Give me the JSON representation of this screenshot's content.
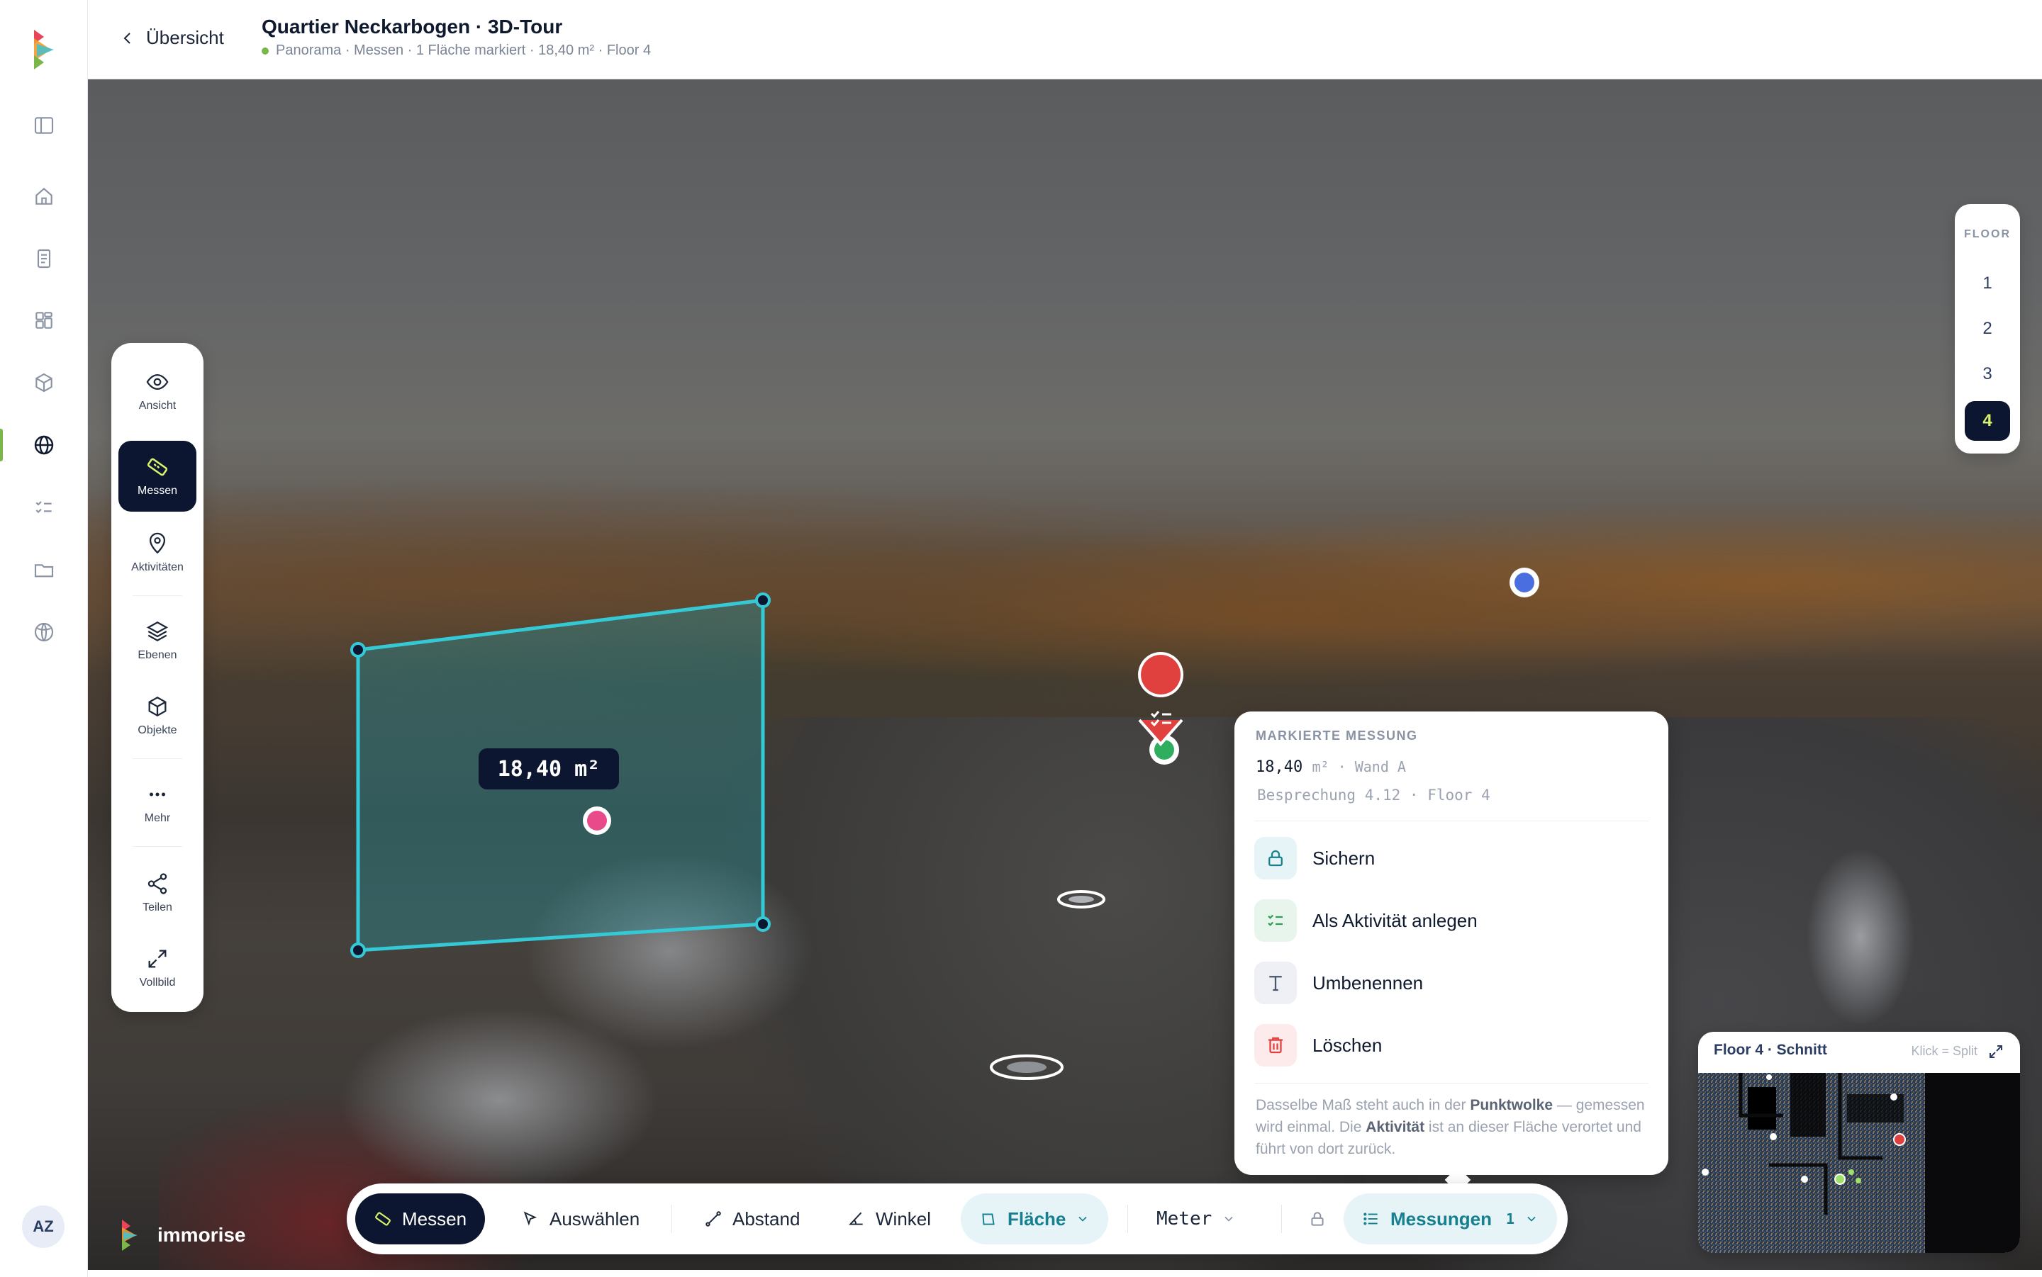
{
  "header": {
    "back_label": "Übersicht",
    "title": "Quartier Neckarbogen · 3D-Tour",
    "subtitle": "Panorama · Messen · 1 Fläche markiert · 18,40 m² · Floor 4"
  },
  "globalnav": {
    "items": [
      "sidebar-toggle-icon",
      "home-icon",
      "document-icon",
      "dashboard-icon",
      "cube-icon",
      "globe-icon",
      "checklist-icon",
      "folder-icon",
      "planet-icon"
    ],
    "active": "globe-icon",
    "avatar_initials": "AZ"
  },
  "rail": {
    "items": [
      {
        "label": "Ansicht",
        "icon": "eye-icon"
      },
      {
        "label": "Messen",
        "icon": "ruler-icon"
      },
      {
        "label": "Aktivitäten",
        "icon": "pin-icon"
      },
      {
        "label": "Ebenen",
        "icon": "layers-icon"
      },
      {
        "label": "Objekte",
        "icon": "cube-icon"
      },
      {
        "label": "Mehr",
        "icon": "more-icon"
      },
      {
        "label": "Teilen",
        "icon": "share-icon"
      },
      {
        "label": "Vollbild",
        "icon": "fullscreen-icon"
      }
    ],
    "active": "Messen"
  },
  "floors": {
    "heading": "FLOOR",
    "items": [
      "1",
      "2",
      "3",
      "4"
    ],
    "active": "4"
  },
  "measurement": {
    "label": "18,40 m²"
  },
  "popover": {
    "heading": "MARKIERTE MESSUNG",
    "value": "18,40",
    "value_meta": "m² · Wand A",
    "location": "Besprechung 4.12 · Floor 4",
    "actions": [
      {
        "label": "Sichern",
        "icon": "lock-icon",
        "color": "#17808f"
      },
      {
        "label": "Als Aktivität anlegen",
        "icon": "checklist-icon",
        "color": "#2e9e57"
      },
      {
        "label": "Umbenennen",
        "icon": "text-icon",
        "color": "#4a5568"
      },
      {
        "label": "Löschen",
        "icon": "trash-icon",
        "color": "#e0413f"
      }
    ],
    "note": {
      "t1": "Dasselbe Maß steht auch in der ",
      "b1": "Punktwolke",
      "t2": " — gemessen wird einmal. Die ",
      "b2": "Aktivität",
      "t3": " ist an dieser Fläche verortet und führt von dort zurück."
    }
  },
  "minimap": {
    "title": "Floor 4 · Schnitt",
    "hint": "Klick = Split"
  },
  "toolbar": {
    "messen": "Messen",
    "auswaehlen": "Auswählen",
    "abstand": "Abstand",
    "winkel": "Winkel",
    "flaeche": "Fläche",
    "unit": "Meter",
    "messungen": "Messungen",
    "messungen_count": "1"
  },
  "brand": {
    "name": "immorise"
  },
  "colors": {
    "accent_dark": "#0c1630",
    "accent_lime": "#d9f26b",
    "measure_cyan": "#35c9d6",
    "teal": "#17808f"
  }
}
